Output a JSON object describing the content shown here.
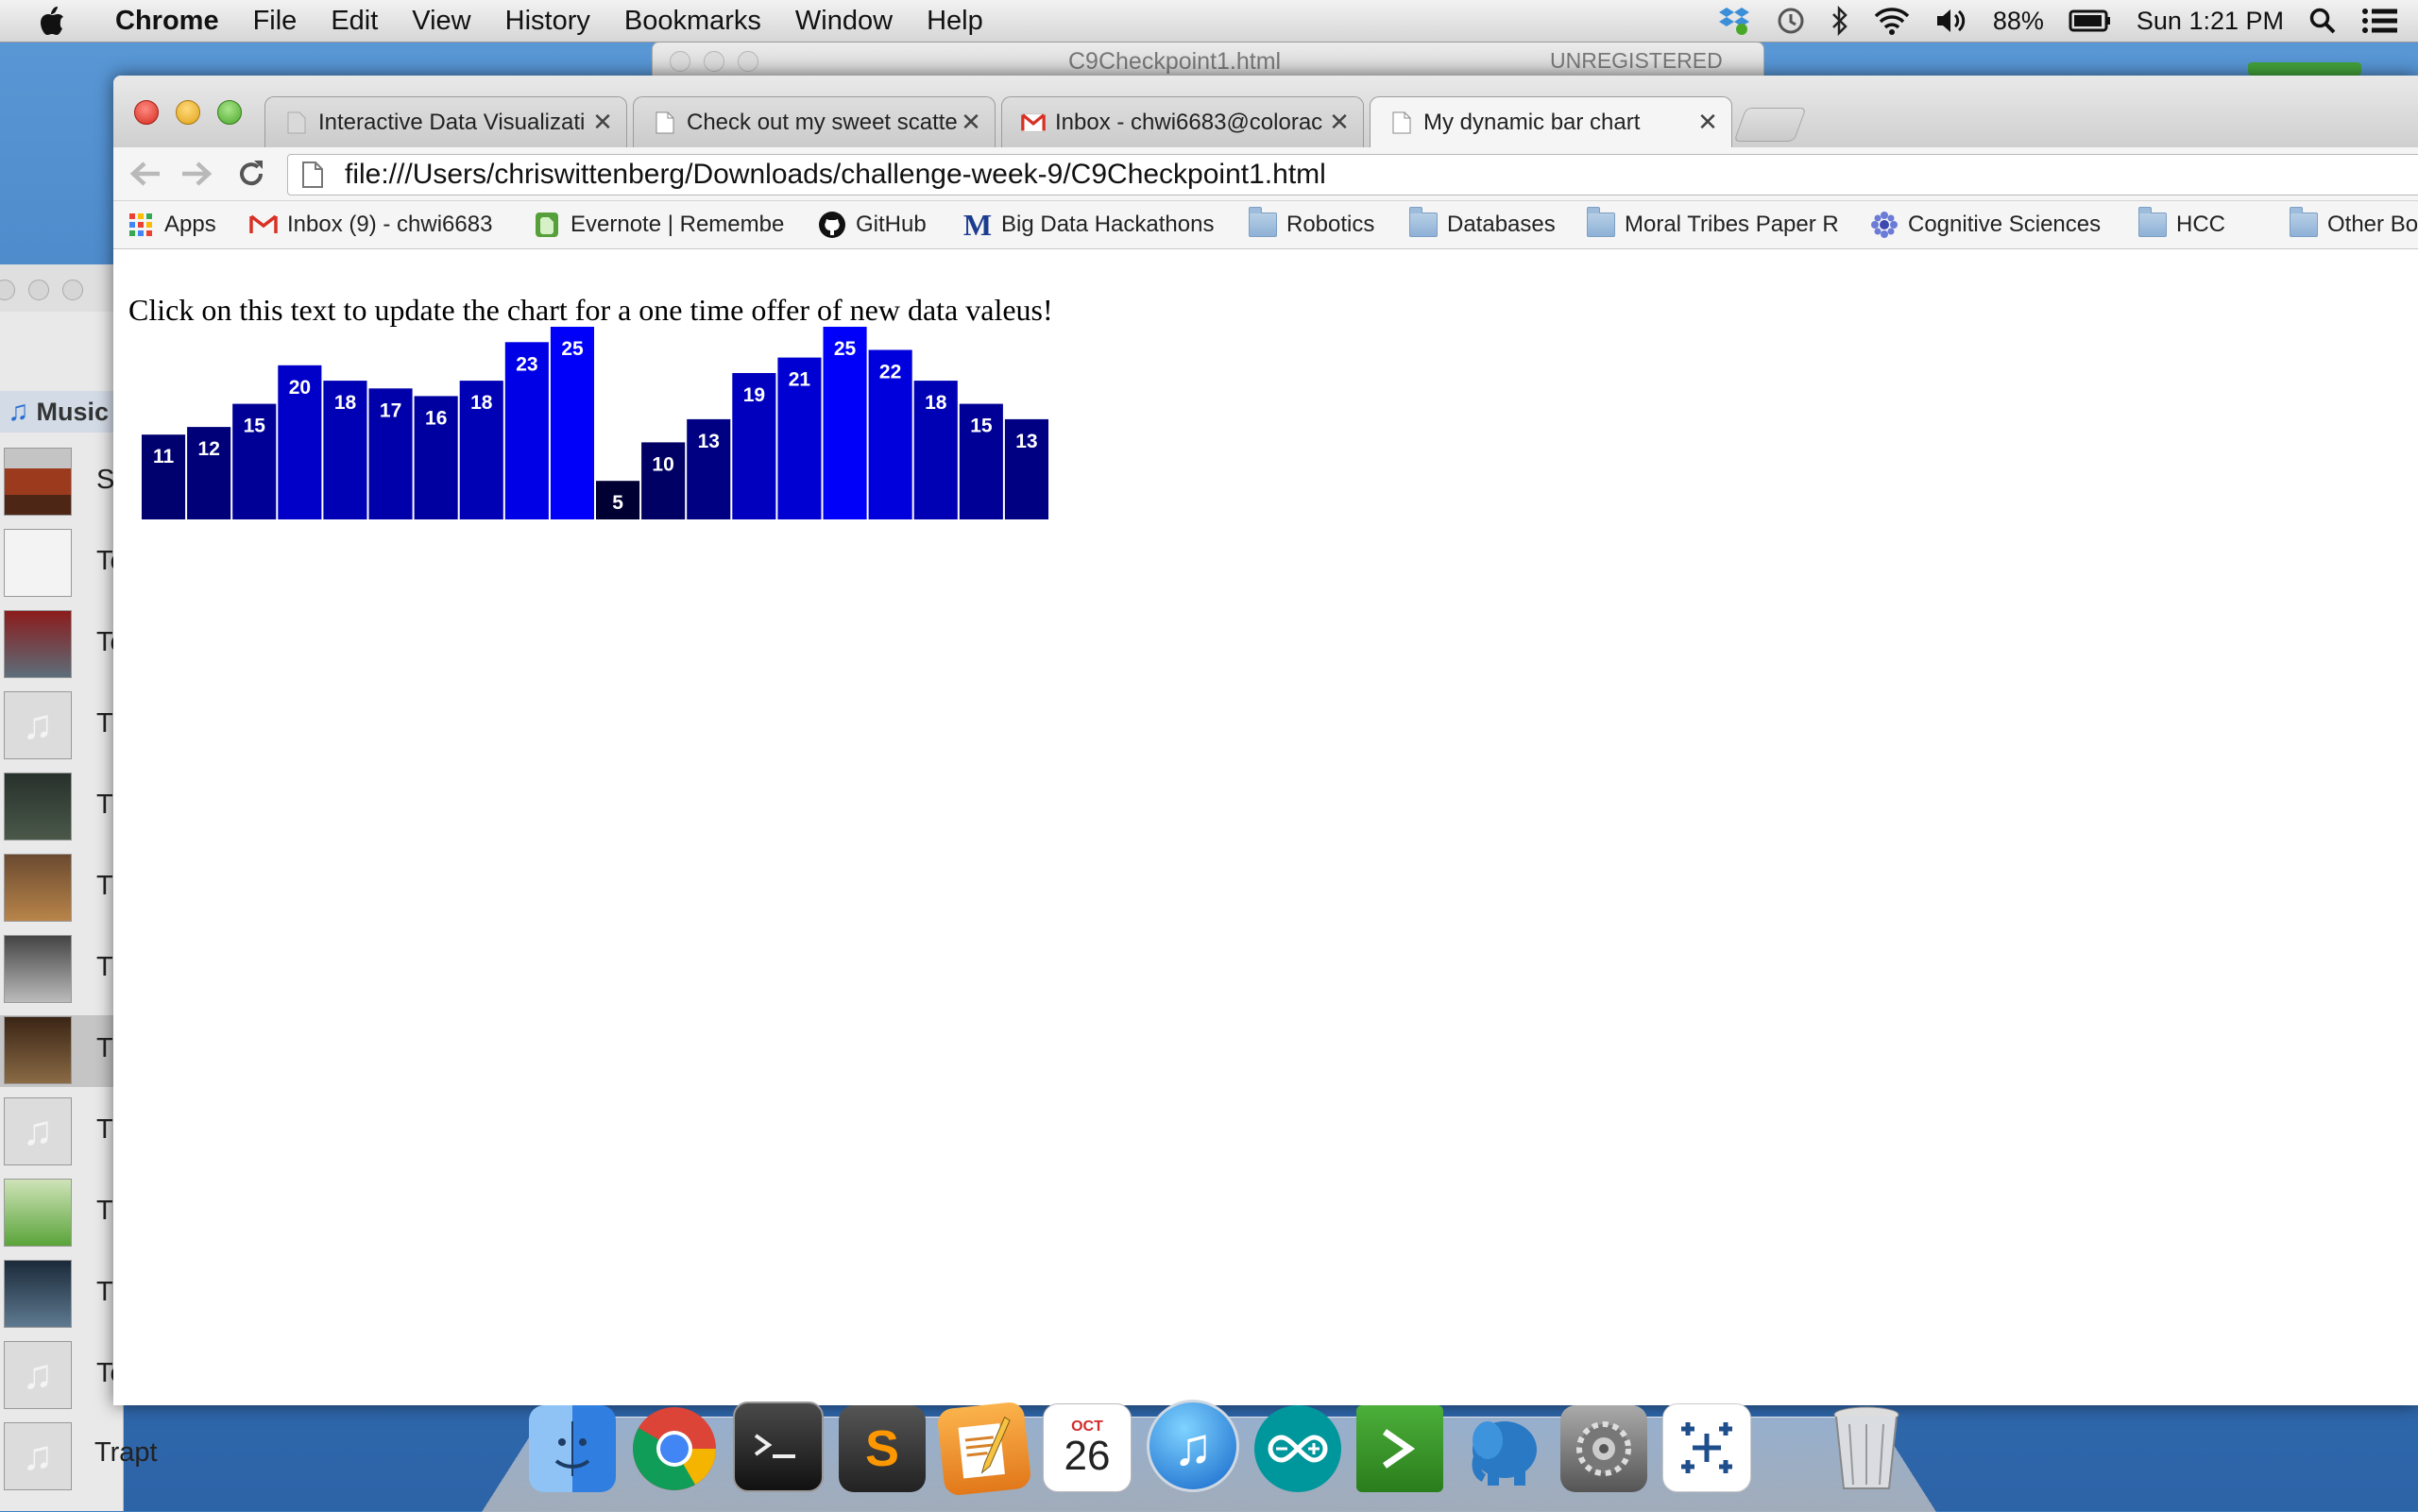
{
  "menubar": {
    "app": "Chrome",
    "items": [
      "File",
      "Edit",
      "View",
      "History",
      "Bookmarks",
      "Window",
      "Help"
    ],
    "battery": "88%",
    "clock": "Sun 1:21 PM"
  },
  "sublime": {
    "title": "C9Checkpoint1.html",
    "status": "UNREGISTERED"
  },
  "itunes": {
    "section": "Music",
    "track_letters": [
      "S",
      "To",
      "To",
      "T",
      "T",
      "T",
      "T",
      "T",
      "T",
      "T",
      "T",
      "To"
    ],
    "last_track": "Trapt"
  },
  "chrome": {
    "tabs": [
      {
        "label": "Interactive Data Visualizati",
        "icon": "page-icon"
      },
      {
        "label": "Check out my sweet scatte",
        "icon": "page-icon"
      },
      {
        "label": "Inbox - chwi6683@colorac",
        "icon": "gmail-icon"
      },
      {
        "label": "My dynamic bar chart",
        "icon": "page-icon"
      }
    ],
    "url": "file:///Users/chriswittenberg/Downloads/challenge-week-9/C9Checkpoint1.html",
    "bookmarks": [
      {
        "label": "Apps",
        "icon": "apps-grid-icon"
      },
      {
        "label": "Inbox (9) - chwi6683",
        "icon": "gmail-icon"
      },
      {
        "label": "Evernote | Remembe",
        "icon": "evernote-icon"
      },
      {
        "label": "GitHub",
        "icon": "github-icon"
      },
      {
        "label": "Big Data Hackathons",
        "icon": "m-logo-icon"
      },
      {
        "label": "Robotics",
        "icon": "folder-icon"
      },
      {
        "label": "Databases",
        "icon": "folder-icon"
      },
      {
        "label": "Moral Tribes Paper R",
        "icon": "folder-icon"
      },
      {
        "label": "Cognitive Sciences",
        "icon": "gear-flower-icon"
      },
      {
        "label": "HCC",
        "icon": "folder-icon"
      },
      {
        "label": "Other Bo",
        "icon": "folder-icon"
      }
    ]
  },
  "page": {
    "prompt": "Click on this text to update the chart for a one time offer of new data valeus!"
  },
  "chart_data": {
    "type": "bar",
    "values": [
      11,
      12,
      15,
      20,
      18,
      17,
      16,
      18,
      23,
      25,
      5,
      10,
      13,
      19,
      21,
      25,
      22,
      18,
      15,
      13
    ],
    "title": "",
    "xlabel": "",
    "ylabel": "",
    "ylim": [
      0,
      25
    ],
    "grid": false,
    "legend": "none",
    "bar_color_rule": "rgb(0,0,value*10)",
    "label_color": "#ffffff"
  },
  "dock": {
    "calendar_month": "OCT",
    "calendar_day": "26",
    "apps": [
      "finder-icon",
      "chrome-icon",
      "terminal-icon",
      "sublime-icon",
      "pages-icon",
      "calendar-icon",
      "itunes-icon",
      "arduino-icon",
      "prompt-icon",
      "elephant-icon",
      "system-preferences-icon",
      "tableau-icon",
      "trash-icon"
    ]
  }
}
